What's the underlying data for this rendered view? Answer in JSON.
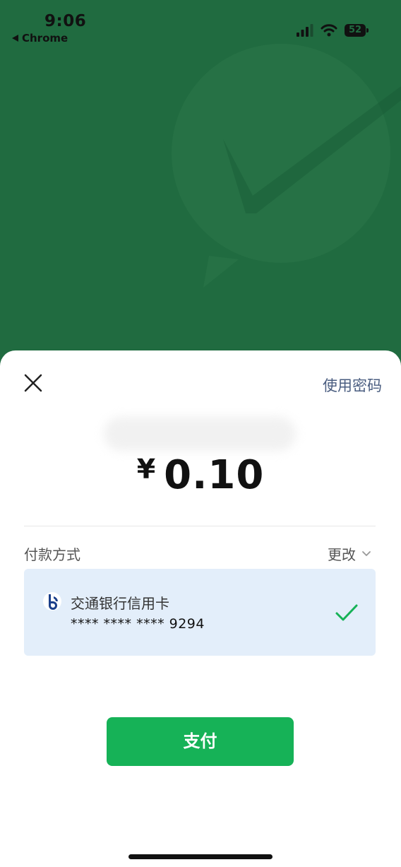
{
  "status_bar": {
    "time": "9:06",
    "back_app": "Chrome",
    "battery": "52"
  },
  "sheet": {
    "close_icon": "close-icon",
    "use_password": "使用密码",
    "merchant_name": "",
    "currency_symbol": "¥",
    "amount": "0.10",
    "payment_method_label": "付款方式",
    "change_label": "更改",
    "card": {
      "bank_name": "交通银行信用卡",
      "card_number": "**** **** **** 9294",
      "selected": true
    },
    "pay_button": "支付"
  },
  "colors": {
    "header_green": "#206b40",
    "pay_button": "#16b257",
    "card_background": "#e3eefa",
    "link_blue": "#4a5d80",
    "check_green": "#16b257"
  }
}
